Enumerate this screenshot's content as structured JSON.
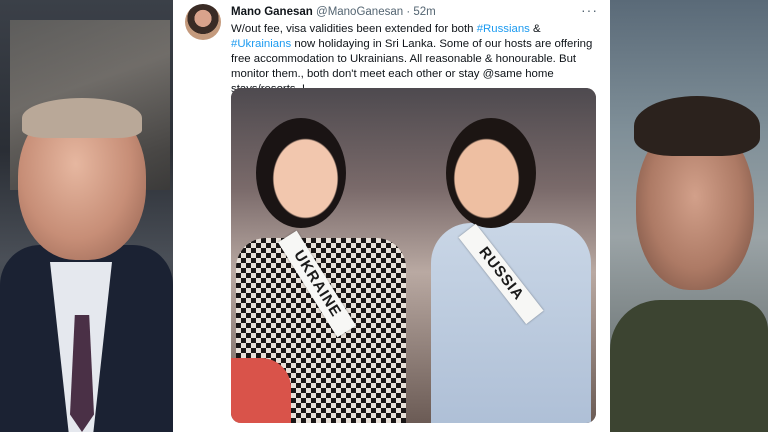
{
  "tweet": {
    "author_name": "Mano Ganesan",
    "author_handle": "@ManoGanesan",
    "separator": "·",
    "time": "52m",
    "more_menu": "···",
    "text_parts": [
      {
        "t": "W/out fee, visa validities been extended for both ",
        "tag": false
      },
      {
        "t": "#Russians",
        "tag": true
      },
      {
        "t": " & ",
        "tag": false
      },
      {
        "t": "#Ukrainians",
        "tag": true
      },
      {
        "t": " now holidaying in Sri Lanka. Some of our hosts are offering free accommodation to Ukrainians. All reasonable & honourable. But monitor them., both don't meet each other or stay @same home stays/resorts..!",
        "tag": false
      }
    ],
    "photo": {
      "sash_left": "UKRAINE",
      "sash_right": "RUSSIA"
    }
  },
  "colors": {
    "link": "#1d9bf0",
    "text": "#0f1419",
    "muted": "#536471"
  }
}
